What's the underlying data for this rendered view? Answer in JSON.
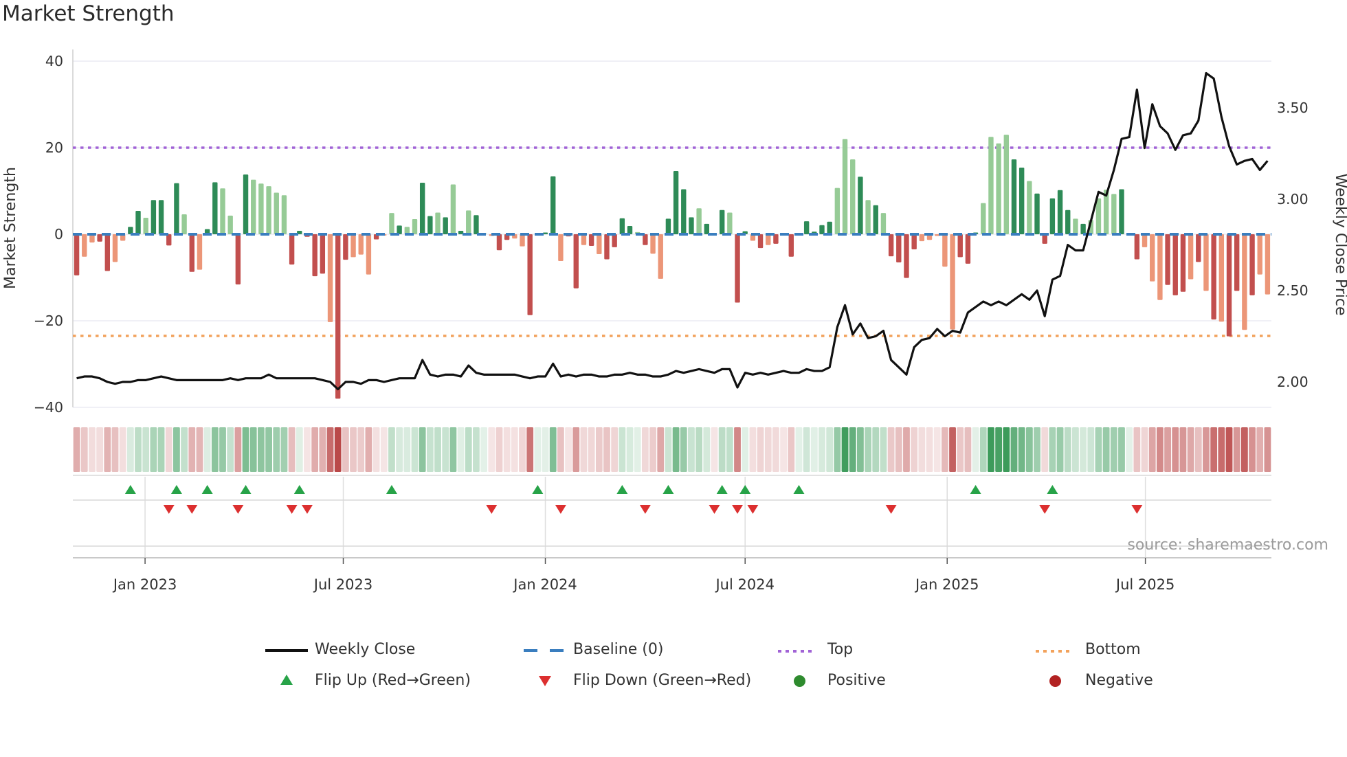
{
  "title": "Market Strength",
  "source": "source: sharemaestro.com",
  "axes": {
    "left_label": "Market Strength",
    "right_label": "Weekly Close Price"
  },
  "legend": {
    "items": [
      {
        "label": "Weekly Close"
      },
      {
        "label": "Baseline (0)"
      },
      {
        "label": "Top"
      },
      {
        "label": "Bottom"
      },
      {
        "label": "Flip Up (Red→Green)"
      },
      {
        "label": "Flip Down (Green→Red)"
      },
      {
        "label": "Positive"
      },
      {
        "label": "Negative"
      }
    ]
  },
  "colors": {
    "bar_pos_dark": "#2e8b57",
    "bar_pos_light": "#96cb96",
    "bar_neg_dark": "#c24f4e",
    "bar_neg_light": "#ec9678",
    "baseline": "#3a7ebf",
    "top": "#a163d6",
    "bottom": "#f2a25c",
    "price_line": "#111111",
    "flip_up": "#27a348",
    "flip_down": "#dc2f2f",
    "positive_dot": "#2e8b2e",
    "negative_dot": "#b22222",
    "grid": "#ebebf3",
    "panel_line": "#d9d9d9",
    "axis_line": "#c9c9c9",
    "tick_text": "#333333"
  },
  "chart_data": {
    "type": "bar+line",
    "x_interval": "weekly",
    "x_start_date": "2022-10-31",
    "n_weeks": 156,
    "baseline": 0,
    "top_threshold": 20,
    "bottom_threshold": -23.5,
    "ylim_left": [
      -40,
      40
    ],
    "left_ticks": [
      {
        "value": 40,
        "label": "40"
      },
      {
        "value": 20,
        "label": "20"
      },
      {
        "value": 0,
        "label": "0"
      },
      {
        "value": -20,
        "label": "−20"
      },
      {
        "value": -40,
        "label": "−40"
      }
    ],
    "right_ticks": [
      {
        "value": 3.5,
        "label": "3.50"
      },
      {
        "value": 3.0,
        "label": "3.00"
      },
      {
        "value": 2.5,
        "label": "2.50"
      },
      {
        "value": 2.0,
        "label": "2.00"
      }
    ],
    "x_ticks": [
      {
        "label": "Jan 2023",
        "week": 8.9
      },
      {
        "label": "Jul 2023",
        "week": 34.7
      },
      {
        "label": "Jan 2024",
        "week": 61.0
      },
      {
        "label": "Jul 2024",
        "week": 87.0
      },
      {
        "label": "Jan 2025",
        "week": 113.3
      },
      {
        "label": "Jul 2025",
        "week": 139.1
      }
    ],
    "strength": [
      -9.5,
      -5.2,
      -1.9,
      -1.7,
      -8.5,
      -6.4,
      -1.5,
      1.7,
      5.4,
      3.8,
      7.9,
      7.9,
      -2.6,
      11.8,
      4.6,
      -8.7,
      -8.2,
      1.2,
      12.0,
      10.6,
      4.3,
      -11.6,
      13.8,
      12.6,
      11.7,
      11.1,
      9.6,
      9.0,
      -7.0,
      0.8,
      -0.6,
      -9.7,
      -9.1,
      -20.3,
      -38.0,
      -5.9,
      -5.3,
      -4.7,
      -9.3,
      -1.2,
      -0.3,
      4.9,
      2.0,
      1.7,
      3.5,
      11.9,
      4.2,
      5.0,
      3.9,
      11.5,
      0.8,
      5.5,
      4.4,
      0.3,
      -0.4,
      -3.7,
      -1.3,
      -1.0,
      -2.8,
      -18.7,
      0.3,
      0.4,
      13.4,
      -6.2,
      -0.5,
      -12.5,
      -2.5,
      -2.7,
      -4.6,
      -5.8,
      -3.0,
      3.7,
      1.9,
      0.5,
      -2.5,
      -4.5,
      -10.3,
      3.6,
      14.6,
      10.4,
      3.9,
      6.0,
      2.4,
      -0.3,
      5.6,
      5.0,
      -15.8,
      0.7,
      -1.5,
      -3.2,
      -2.5,
      -2.2,
      -0.3,
      -5.2,
      0.3,
      3.0,
      0.6,
      2.1,
      2.9,
      10.7,
      22.0,
      17.3,
      13.3,
      7.9,
      6.7,
      4.9,
      -5.1,
      -6.5,
      -10.1,
      -3.5,
      -1.6,
      -1.3,
      -0.4,
      -7.5,
      -22.0,
      -5.3,
      -6.8,
      0.4,
      7.2,
      22.5,
      21.0,
      23.0,
      17.3,
      15.4,
      12.3,
      9.4,
      -2.2,
      8.3,
      10.2,
      5.6,
      3.6,
      2.4,
      3.3,
      8.3,
      10.3,
      9.3,
      10.4,
      0.2,
      -5.8,
      -3.0,
      -10.9,
      -15.2,
      -11.7,
      -14.1,
      -13.3,
      -10.4,
      -6.4,
      -13.1,
      -19.7,
      -20.2,
      -23.6,
      -13.1,
      -22.1,
      -14.1,
      -9.3,
      -13.9
    ],
    "strength_shade": "dllddllddlddddldlddllddllllldddddlddllldlldllddldldldllddllddddlddldlddddldllddddldldlddldldddlddddllldldlddddllllldddllllddldddddldlllldddllldddldldlddldllldddldlll",
    "close": [
      2.02,
      2.03,
      2.03,
      2.02,
      2.0,
      1.99,
      2.0,
      2.0,
      2.01,
      2.01,
      2.02,
      2.03,
      2.02,
      2.01,
      2.01,
      2.01,
      2.01,
      2.01,
      2.01,
      2.01,
      2.02,
      2.01,
      2.02,
      2.02,
      2.02,
      2.04,
      2.02,
      2.02,
      2.02,
      2.02,
      2.02,
      2.02,
      2.01,
      2.0,
      1.96,
      2.0,
      2.0,
      1.99,
      2.01,
      2.01,
      2.0,
      2.01,
      2.02,
      2.02,
      2.02,
      2.12,
      2.04,
      2.03,
      2.04,
      2.04,
      2.03,
      2.09,
      2.05,
      2.04,
      2.04,
      2.04,
      2.04,
      2.04,
      2.03,
      2.02,
      2.03,
      2.03,
      2.1,
      2.03,
      2.04,
      2.03,
      2.04,
      2.04,
      2.03,
      2.03,
      2.04,
      2.04,
      2.05,
      2.04,
      2.04,
      2.03,
      2.03,
      2.04,
      2.06,
      2.05,
      2.06,
      2.07,
      2.06,
      2.05,
      2.07,
      2.07,
      1.97,
      2.05,
      2.04,
      2.05,
      2.04,
      2.05,
      2.06,
      2.05,
      2.05,
      2.07,
      2.06,
      2.06,
      2.08,
      2.3,
      2.42,
      2.26,
      2.32,
      2.24,
      2.25,
      2.28,
      2.12,
      2.08,
      2.04,
      2.19,
      2.23,
      2.24,
      2.29,
      2.25,
      2.28,
      2.27,
      2.38,
      2.41,
      2.44,
      2.42,
      2.44,
      2.42,
      2.45,
      2.48,
      2.45,
      2.5,
      2.36,
      2.56,
      2.58,
      2.75,
      2.72,
      2.72,
      2.88,
      3.04,
      3.02,
      3.16,
      3.33,
      3.34,
      3.6,
      3.28,
      3.52,
      3.4,
      3.36,
      3.27,
      3.35,
      3.36,
      3.43,
      3.69,
      3.66,
      3.45,
      3.29,
      3.19,
      3.21,
      3.22,
      3.16,
      3.21
    ],
    "flip_up_weeks": [
      7,
      13,
      17,
      22,
      29,
      41,
      60,
      71,
      77,
      84,
      87,
      94,
      117,
      127
    ],
    "flip_down_weeks": [
      12,
      15,
      21,
      28,
      30,
      54,
      63,
      74,
      83,
      86,
      88,
      106,
      126,
      138
    ]
  }
}
